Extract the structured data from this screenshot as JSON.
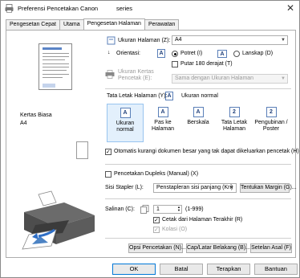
{
  "window": {
    "title": "Preferensi Pencetakan Canon",
    "title_suffix": "series"
  },
  "tabs": [
    {
      "label": "Pengesetan Cepat"
    },
    {
      "label": "Utama"
    },
    {
      "label": "Pengesetan Halaman"
    },
    {
      "label": "Perawatan"
    }
  ],
  "preview": {
    "paper_type": "Kertas Biasa",
    "paper_size": "A4"
  },
  "page_size": {
    "label": "Ukuran Halaman (Z):",
    "value": "A4"
  },
  "orientation": {
    "label": "Orientasi:",
    "portrait": "Potret (I)",
    "landscape": "Lanskap (D)",
    "rotate180": "Putar 180 derajat (T)",
    "portrait_icon": "A",
    "landscape_icon": "A"
  },
  "printer_paper": {
    "label": "Ukuran Kertas Pencetak (E):",
    "value": "Sama dengan Ukuran Halaman"
  },
  "layout": {
    "label": "Tata Letak Halaman (Y):",
    "current": "Ukuran normal",
    "items": [
      {
        "label": "Ukuran normal",
        "icon": "A"
      },
      {
        "label": "Pas ke Halaman",
        "icon": "A"
      },
      {
        "label": "Berskala",
        "icon": "A"
      },
      {
        "label": "Tata Letak Halaman",
        "icon": "2"
      },
      {
        "label": "Pengubinan / Poster",
        "icon": "2"
      }
    ]
  },
  "auto_reduce": {
    "label": "Otomatis kurangi dokumen besar yang tak dapat dikeluarkan pencetak (H)"
  },
  "duplex": {
    "label": "Pencetakan Dupleks (Manual) (X)"
  },
  "stapler": {
    "label": "Sisi Stapler (L):",
    "value": "Penstapleran sisi panjang (Kri)",
    "margin_button": "Tentukan Margin (G)..."
  },
  "copies": {
    "label": "Salinan (C):",
    "value": "1",
    "range": "(1-999)",
    "last_page_first": "Cetak dari Halaman Terakhir (R)",
    "collate": "Kolasi (O)"
  },
  "buttons": {
    "print_options": "Opsi Pencetakan (N)...",
    "stamp_background": "Cap/Latar Belakang (B)...",
    "defaults": "Setelan Asal (F)",
    "ok": "OK",
    "cancel": "Batal",
    "apply": "Terapkan",
    "help": "Bantuan"
  }
}
